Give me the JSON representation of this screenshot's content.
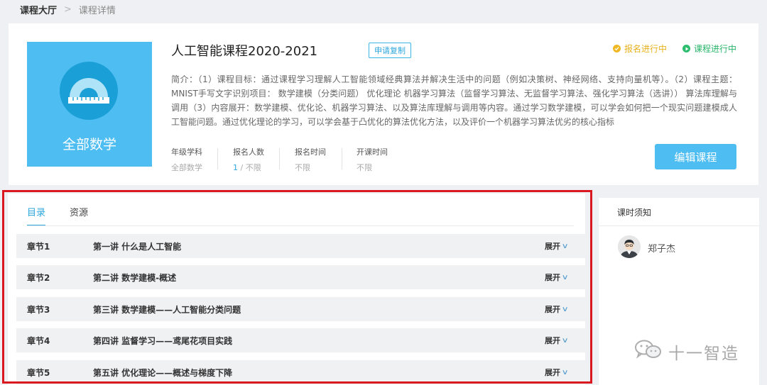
{
  "breadcrumb": {
    "home": "课程大厅",
    "separator": ">",
    "current": "课程详情"
  },
  "course": {
    "cover_text": "全部数学",
    "title": "人工智能课程2020-2021",
    "copy_label": "申请复制",
    "status_enroll": "报名进行中",
    "status_course": "课程进行中",
    "intro": "简介：（1）课程目标：通过课程学习理解人工智能领域经典算法并解决生活中的问题（例如决策树、神经网络、支持向量机等）。（2）课程主题：MNIST手写文字识别项目：  数学建模（分类问题）  优化理论  机器学习算法（监督学习算法、无监督学习算法、强化学习算法（选讲））  算法库理解与调用（3）内容展开：数学建模、优化论、机器学习算法、以及算法库理解与调用等内容。通过学习数学建模，可以学会如何把一个现实问题建模成人工智能问题。通过优化理论的学习，可以学会基于凸优化的算法优化方法，以及评价一个机器学习算法优劣的核心指标",
    "meta": [
      {
        "label": "年级学科",
        "value": "全部数学"
      },
      {
        "label": "报名人数",
        "value_highlight": "1",
        "value_rest": " / 不限"
      },
      {
        "label": "报名时间",
        "value": "不限"
      },
      {
        "label": "开课时间",
        "value": "不限"
      }
    ],
    "edit_label": "编辑课程"
  },
  "catalog": {
    "tabs": [
      {
        "label": "目录"
      },
      {
        "label": "资源"
      }
    ],
    "expand_label": "展开",
    "chapters": [
      {
        "num": "章节1",
        "title": "第一讲 什么是人工智能"
      },
      {
        "num": "章节2",
        "title": "第二讲 数学建模-概述"
      },
      {
        "num": "章节3",
        "title": "第三讲 数学建模——人工智能分类问题"
      },
      {
        "num": "章节4",
        "title": "第四讲 监督学习——鸢尾花项目实践"
      },
      {
        "num": "章节5",
        "title": "第五讲 优化理论——概述与梯度下降"
      }
    ]
  },
  "notice": {
    "title": "课时须知",
    "teacher": "郑子杰"
  },
  "watermark": {
    "text": "十一智造"
  },
  "colors": {
    "accent": "#4dbdf2",
    "link": "#2aa6dd",
    "frame": "#d9181f",
    "enroll": "#f0b824",
    "active": "#2cbd6e"
  }
}
